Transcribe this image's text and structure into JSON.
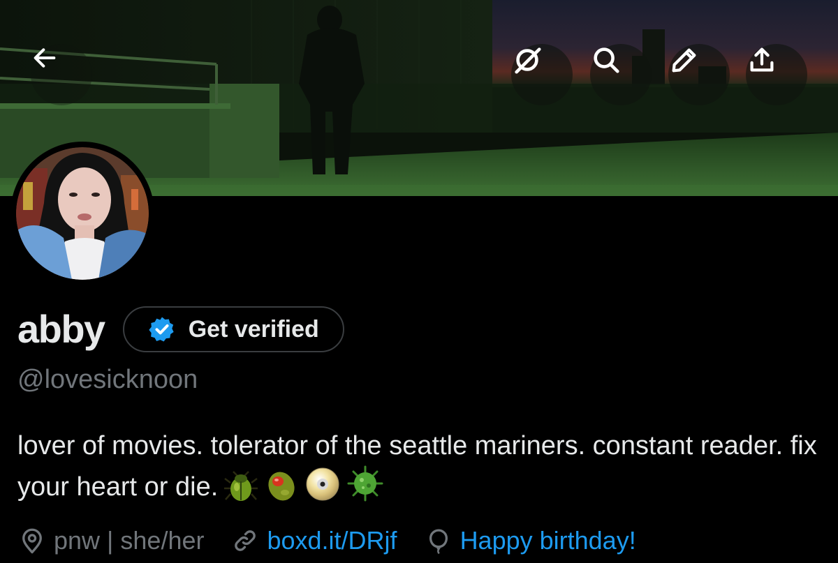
{
  "header": {
    "back": "back-arrow-icon",
    "actions": [
      "grok-icon",
      "search-icon",
      "edit-pencil-icon",
      "share-upload-icon"
    ]
  },
  "profile": {
    "display_name": "abby",
    "verify_button": "Get verified",
    "handle": "@lovesicknoon",
    "bio": "lover of movies. tolerator of the seattle mariners. constant reader. fix your heart or die.",
    "bio_emojis": [
      "beetle",
      "olive",
      "dvd",
      "microbe"
    ],
    "location": "pnw | she/her",
    "website": "boxd.it/DRjf",
    "birthday": "Happy birthday!"
  },
  "colors": {
    "background": "#000000",
    "text_primary": "#e7e9ea",
    "text_secondary": "#71767b",
    "link": "#1d9bf0",
    "verified_badge": "#1d9bf0"
  }
}
